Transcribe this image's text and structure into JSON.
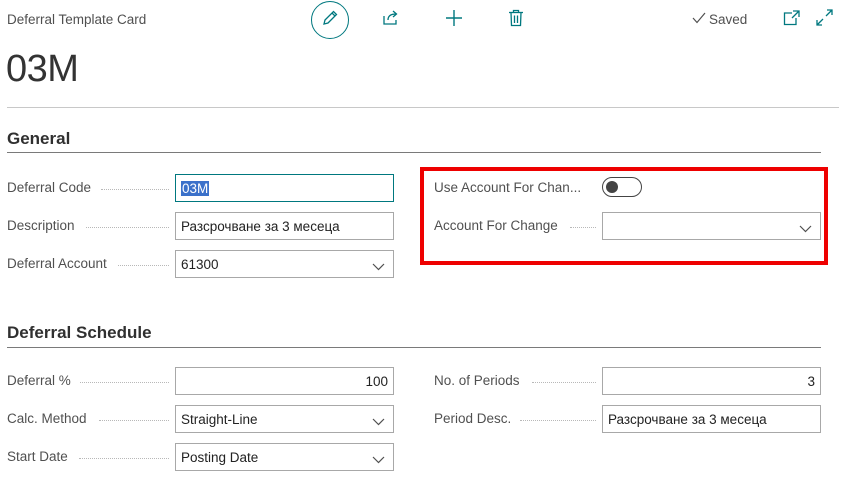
{
  "header": {
    "card_title": "Deferral Template Card",
    "record_title": "03M",
    "status": "Saved",
    "toolbar_icons": [
      "pencil-icon",
      "share-icon",
      "plus-icon",
      "trash-icon",
      "open-in-new-window-icon",
      "expand-icon"
    ]
  },
  "general": {
    "section_title": "General",
    "deferral_code_label": "Deferral Code",
    "deferral_code_value": "03M",
    "description_label": "Description",
    "description_value": "Разсрочване за 3 месеца",
    "deferral_account_label": "Deferral Account",
    "deferral_account_value": "61300",
    "use_account_for_change_label": "Use Account For Chan...",
    "use_account_for_change_value": false,
    "account_for_change_label": "Account For Change",
    "account_for_change_value": ""
  },
  "schedule": {
    "section_title": "Deferral Schedule",
    "deferral_pct_label": "Deferral %",
    "deferral_pct_value": "100",
    "calc_method_label": "Calc. Method",
    "calc_method_value": "Straight-Line",
    "start_date_label": "Start Date",
    "start_date_value": "Posting Date",
    "no_of_periods_label": "No. of Periods",
    "no_of_periods_value": "3",
    "period_desc_label": "Period Desc.",
    "period_desc_value": "Разсрочване за 3 месеца"
  },
  "colors": {
    "accent": "#00787f",
    "highlight": "#ee0000",
    "selection": "#3b71ca"
  }
}
